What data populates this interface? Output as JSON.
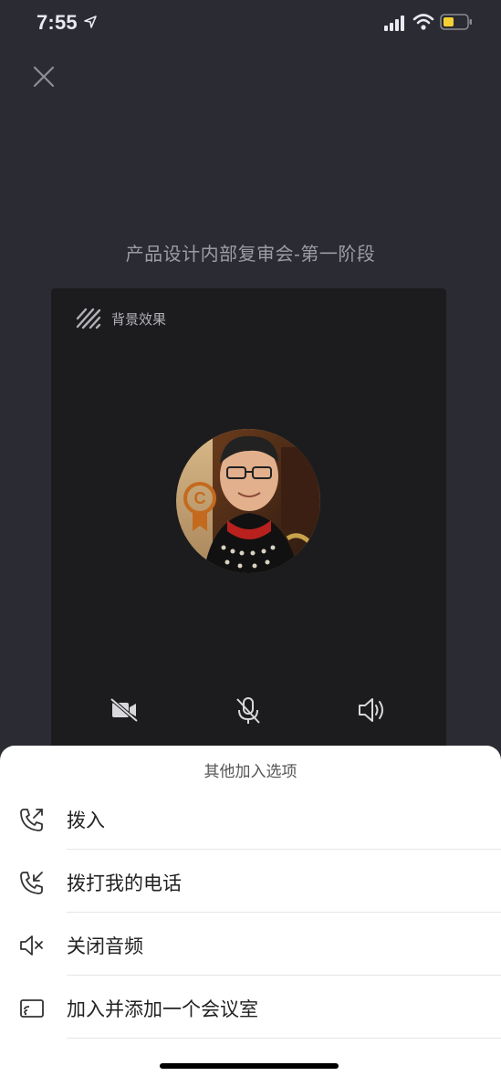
{
  "status_bar": {
    "time": "7:55",
    "icons": [
      "location-arrow-icon",
      "cellular-signal-icon",
      "wifi-icon",
      "battery-icon"
    ]
  },
  "header": {
    "close_icon": "close-icon"
  },
  "meeting": {
    "title": "产品设计内部复审会-第一阶段"
  },
  "preview": {
    "background_effect_label": "背景效果",
    "background_effect_icon": "background-effect-icon",
    "avatar": "user-avatar-photo",
    "controls": [
      {
        "name": "camera-off",
        "icon": "video-off-icon"
      },
      {
        "name": "mic-off",
        "icon": "mic-off-icon"
      },
      {
        "name": "speaker",
        "icon": "speaker-icon"
      }
    ]
  },
  "sheet": {
    "title": "其他加入选项",
    "options": [
      {
        "label": "拨入",
        "icon": "phone-outgoing-icon"
      },
      {
        "label": "拨打我的电话",
        "icon": "phone-incoming-icon"
      },
      {
        "label": "关闭音频",
        "icon": "speaker-mute-icon"
      },
      {
        "label": "加入并添加一个会议室",
        "icon": "cast-screen-icon"
      }
    ]
  },
  "colors": {
    "background": "#2b2b33",
    "preview_bg": "#1c1c1e",
    "sheet_bg": "#ffffff",
    "battery_level": "#f5d033"
  }
}
